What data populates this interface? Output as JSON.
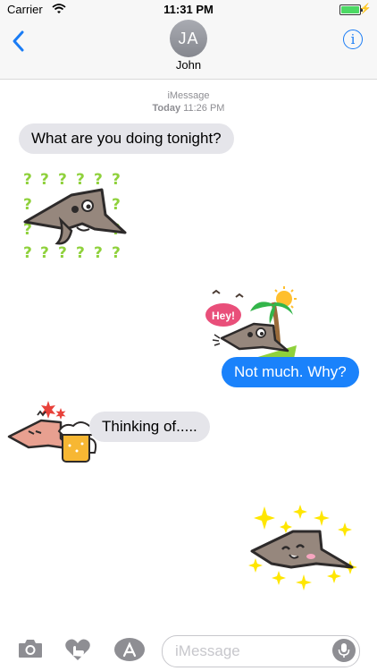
{
  "status_bar": {
    "carrier": "Carrier",
    "time": "11:31 PM"
  },
  "nav": {
    "contact_initials": "JA",
    "contact_name": "John",
    "info_glyph": "i"
  },
  "thread": {
    "service": "iMessage",
    "day": "Today",
    "time": "11:26 PM",
    "messages": [
      {
        "from": "them",
        "text": "What are you doing tonight?"
      },
      {
        "from": "them",
        "sticker": "question-marks-creature-sticker"
      },
      {
        "from": "me",
        "sticker": "beach-hey-creature-sticker",
        "sticker_text": "Hey!"
      },
      {
        "from": "me",
        "text": "Not much. Why?"
      },
      {
        "from": "them",
        "sticker": "beer-creature-sticker"
      },
      {
        "from": "them",
        "text": "Thinking of....."
      },
      {
        "from": "me",
        "sticker": "sparkles-creature-sticker"
      }
    ]
  },
  "composer": {
    "placeholder": "iMessage"
  },
  "colors": {
    "accent": "#1a7cf5",
    "outgoing_bubble": "#1a82fb",
    "incoming_bubble": "#e5e5ea",
    "question_marks": "#8fd13c",
    "sparkles": "#ffe600"
  },
  "icons": [
    "wifi-icon",
    "battery-icon",
    "back-chevron-icon",
    "info-icon",
    "camera-icon",
    "digital-touch-icon",
    "app-store-icon",
    "microphone-icon"
  ]
}
